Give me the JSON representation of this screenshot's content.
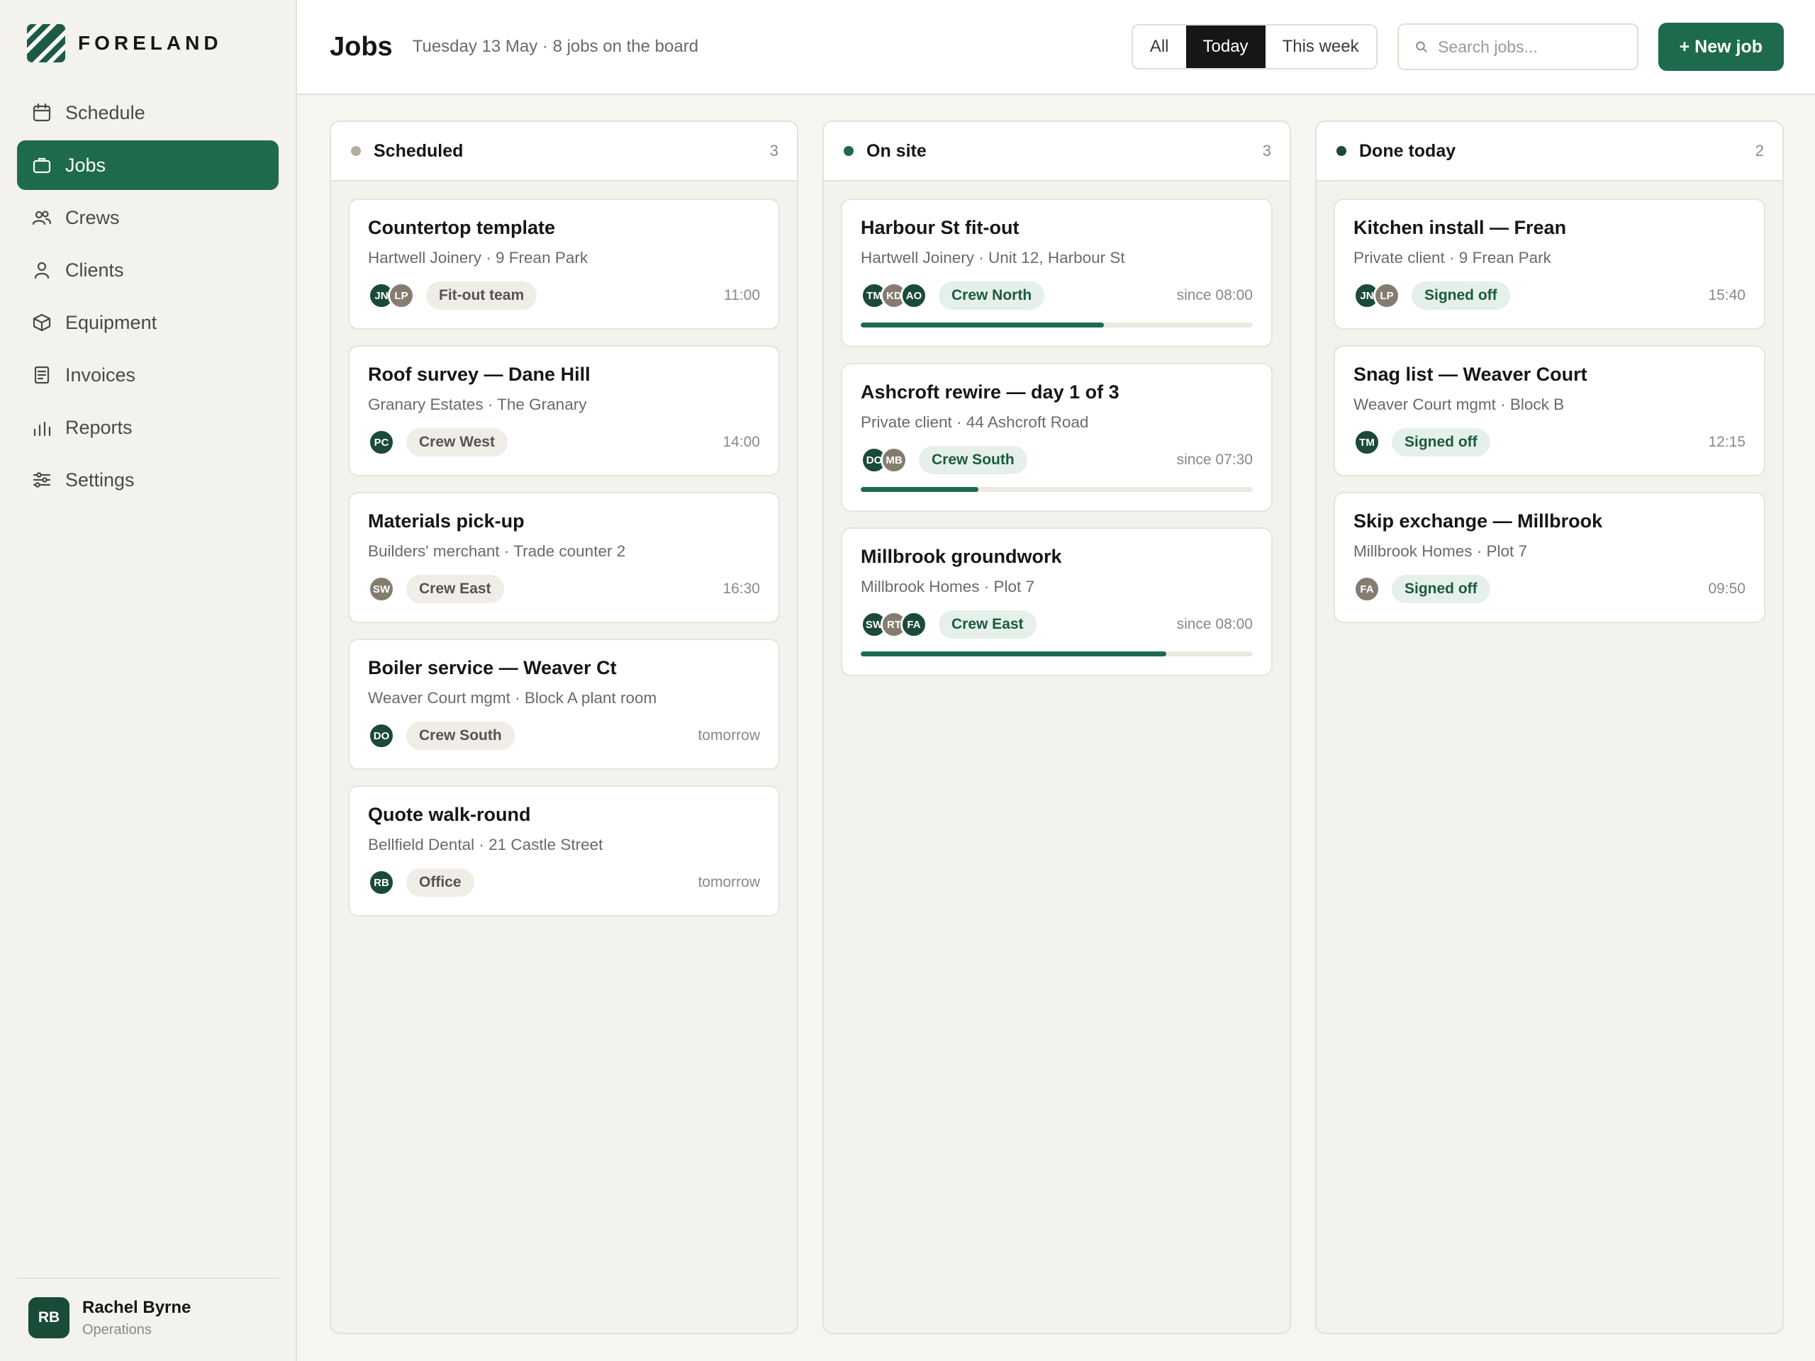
{
  "brand": {
    "name": "FORELAND"
  },
  "nav": [
    {
      "label": "Schedule",
      "icon": "calendar-icon",
      "active": false
    },
    {
      "label": "Jobs",
      "icon": "briefcase-icon",
      "active": true
    },
    {
      "label": "Crews",
      "icon": "users-icon",
      "active": false
    },
    {
      "label": "Clients",
      "icon": "user-icon",
      "active": false
    },
    {
      "label": "Equipment",
      "icon": "box-icon",
      "active": false
    },
    {
      "label": "Invoices",
      "icon": "invoice-icon",
      "active": false
    },
    {
      "label": "Reports",
      "icon": "bar-chart-icon",
      "active": false
    },
    {
      "label": "Settings",
      "icon": "sliders-icon",
      "active": false
    }
  ],
  "user": {
    "initials": "RB",
    "name": "Rachel Byrne",
    "role": "Operations"
  },
  "header": {
    "title": "Jobs",
    "subtitle": "Tuesday 13 May · 8 jobs on the board",
    "filters": [
      {
        "label": "All",
        "active": false
      },
      {
        "label": "Today",
        "active": true
      },
      {
        "label": "This week",
        "active": false
      }
    ],
    "search_placeholder": "Search jobs...",
    "new_job_label": "+ New job"
  },
  "colors": {
    "accent": "#1d6b4c",
    "dark_green": "#1a4a38",
    "taupe": "#857c70",
    "scheduled_dot": "#b3aca0",
    "onsite_dot": "#1d6b4c",
    "done_dot": "#1a4a38"
  },
  "columns": [
    {
      "title": "Scheduled",
      "count": "3",
      "dot": "scheduled_dot",
      "cards": [
        {
          "title": "Countertop template",
          "sub": "Hartwell Joinery · 9 Frean Park",
          "avatars": [
            {
              "i": "JN",
              "c": "dark_green"
            },
            {
              "i": "LP",
              "c": "taupe"
            }
          ],
          "tag": "Fit-out team",
          "tag_style": "neutral",
          "time": "11:00"
        },
        {
          "title": "Roof survey — Dane Hill",
          "sub": "Granary Estates · The Granary",
          "avatars": [
            {
              "i": "PC",
              "c": "dark_green"
            }
          ],
          "tag": "Crew West",
          "tag_style": "neutral",
          "time": "14:00"
        },
        {
          "title": "Materials pick-up",
          "sub": "Builders' merchant · Trade counter 2",
          "avatars": [
            {
              "i": "SW",
              "c": "taupe"
            }
          ],
          "tag": "Crew East",
          "tag_style": "neutral",
          "time": "16:30"
        },
        {
          "title": "Boiler service — Weaver Ct",
          "sub": "Weaver Court mgmt · Block A plant room",
          "avatars": [
            {
              "i": "DO",
              "c": "dark_green"
            }
          ],
          "tag": "Crew South",
          "tag_style": "neutral",
          "time": "tomorrow"
        },
        {
          "title": "Quote walk-round",
          "sub": "Bellfield Dental · 21 Castle Street",
          "avatars": [
            {
              "i": "RB",
              "c": "dark_green"
            }
          ],
          "tag": "Office",
          "tag_style": "neutral",
          "time": "tomorrow"
        }
      ]
    },
    {
      "title": "On site",
      "count": "3",
      "dot": "onsite_dot",
      "cards": [
        {
          "title": "Harbour St fit-out",
          "sub": "Hartwell Joinery · Unit 12, Harbour St",
          "avatars": [
            {
              "i": "TM",
              "c": "dark_green"
            },
            {
              "i": "KD",
              "c": "taupe"
            },
            {
              "i": "AO",
              "c": "dark_green"
            }
          ],
          "tag": "Crew North",
          "tag_style": "green",
          "time": "since 08:00",
          "progress": 62
        },
        {
          "title": "Ashcroft rewire — day 1 of 3",
          "sub": "Private client · 44 Ashcroft Road",
          "avatars": [
            {
              "i": "DO",
              "c": "dark_green"
            },
            {
              "i": "MB",
              "c": "taupe"
            }
          ],
          "tag": "Crew South",
          "tag_style": "green",
          "time": "since 07:30",
          "progress": 30
        },
        {
          "title": "Millbrook groundwork",
          "sub": "Millbrook Homes · Plot 7",
          "avatars": [
            {
              "i": "SW",
              "c": "dark_green"
            },
            {
              "i": "RT",
              "c": "taupe"
            },
            {
              "i": "FA",
              "c": "dark_green"
            }
          ],
          "tag": "Crew East",
          "tag_style": "green",
          "time": "since 08:00",
          "progress": 78
        }
      ]
    },
    {
      "title": "Done today",
      "count": "2",
      "dot": "done_dot",
      "cards": [
        {
          "title": "Kitchen install — Frean",
          "sub": "Private client · 9 Frean Park",
          "avatars": [
            {
              "i": "JN",
              "c": "dark_green"
            },
            {
              "i": "LP",
              "c": "taupe"
            }
          ],
          "tag": "Signed off",
          "tag_style": "green",
          "time": "15:40"
        },
        {
          "title": "Snag list — Weaver Court",
          "sub": "Weaver Court mgmt · Block B",
          "avatars": [
            {
              "i": "TM",
              "c": "dark_green"
            }
          ],
          "tag": "Signed off",
          "tag_style": "green",
          "time": "12:15"
        },
        {
          "title": "Skip exchange — Millbrook",
          "sub": "Millbrook Homes · Plot 7",
          "avatars": [
            {
              "i": "FA",
              "c": "taupe"
            }
          ],
          "tag": "Signed off",
          "tag_style": "green",
          "time": "09:50"
        }
      ]
    }
  ]
}
